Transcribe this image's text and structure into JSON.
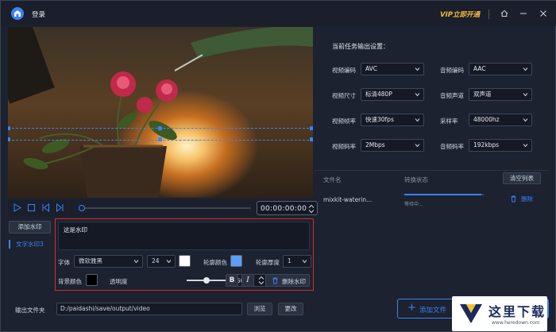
{
  "titlebar": {
    "login": "登录",
    "vip": "VIP立即开通"
  },
  "player": {
    "timecode": "00:00:00:00"
  },
  "watermark": {
    "add_button": "添加水印",
    "items": [
      {
        "label": "文字水印3"
      }
    ],
    "text": "这是水印",
    "font_label": "字体",
    "font_value": "微软雅黑",
    "size_value": "24",
    "outline_color_label": "轮廓颜色",
    "outline_width_label": "轮廓厚度",
    "outline_width_value": "1",
    "bg_color_label": "背景颜色",
    "opacity_label": "透明度",
    "opacity_value": "50 %",
    "opacity": 0.5,
    "bold_label": "B",
    "italic_label": "I",
    "delete_button": "删除水印",
    "colors": {
      "font": "#ffffff",
      "outline": "#5b9ef4",
      "background": "#000000"
    }
  },
  "output": {
    "label": "输出文件夹",
    "path": "D:/paidashi/save/output/video",
    "browse": "浏览",
    "change": "更改"
  },
  "settings": {
    "title": "当前任务输出设置：",
    "video_codec_label": "视频编码",
    "video_codec": "AVC",
    "audio_codec_label": "音频编码",
    "audio_codec": "AAC",
    "video_size_label": "视频尺寸",
    "video_size": "标清480P",
    "audio_channel_label": "音频声道",
    "audio_channel": "双声道",
    "frame_rate_label": "视频帧率",
    "frame_rate": "快速30fps",
    "sample_rate_label": "采样率",
    "sample_rate": "48000hz",
    "video_bitrate_label": "视频码率",
    "video_bitrate": "2Mbps",
    "audio_bitrate_label": "音频码率",
    "audio_bitrate": "192kbps"
  },
  "file_list": {
    "col_file": "文件名",
    "col_status": "转换状态",
    "clear_button": "清空列表",
    "rows": [
      {
        "name": "mixkit-waterin...",
        "status": "等待中...",
        "progress": 0.97,
        "delete": "删除"
      }
    ]
  },
  "actions": {
    "add_file": "添加文件"
  },
  "site_watermark": {
    "title": "这里下载",
    "url": "www.heredown.com"
  },
  "accent_color": "#3b82f6"
}
